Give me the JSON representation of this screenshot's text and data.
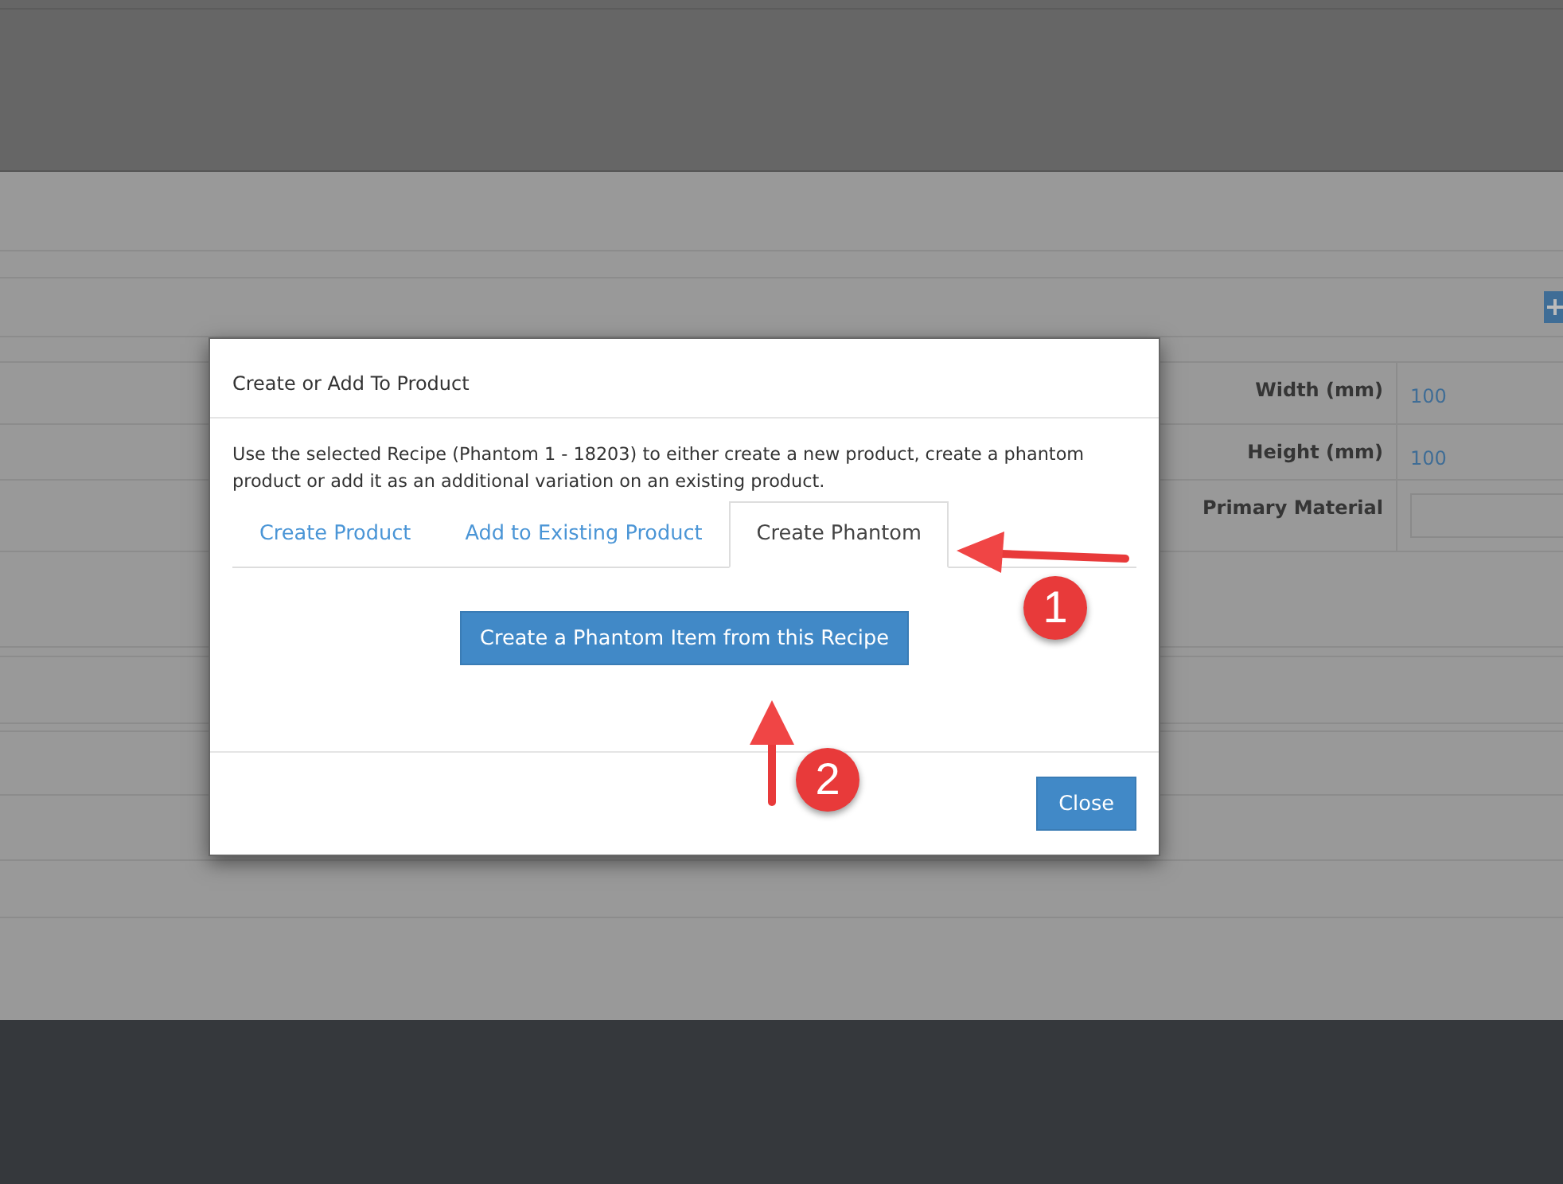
{
  "background": {
    "fields": [
      {
        "label": "Width (mm)",
        "value": "100",
        "kind": "text"
      },
      {
        "label": "Height (mm)",
        "value": "100",
        "kind": "text"
      },
      {
        "label": "Primary Material",
        "kind": "input"
      }
    ]
  },
  "dialog": {
    "title": "Create or Add To Product",
    "description": "Use the selected Recipe (Phantom 1 - 18203) to either create a new product, create a phantom product or add it as an additional variation on an existing product.",
    "tabs": [
      {
        "label": "Create Product",
        "selected": false
      },
      {
        "label": "Add to Existing Product",
        "selected": false
      },
      {
        "label": "Create Phantom",
        "selected": true
      }
    ],
    "action_button": "Create a Phantom Item from this Recipe",
    "close_button": "Close"
  },
  "annotations": [
    {
      "number": "1",
      "kind": "left"
    },
    {
      "number": "2",
      "kind": "up"
    }
  ]
}
